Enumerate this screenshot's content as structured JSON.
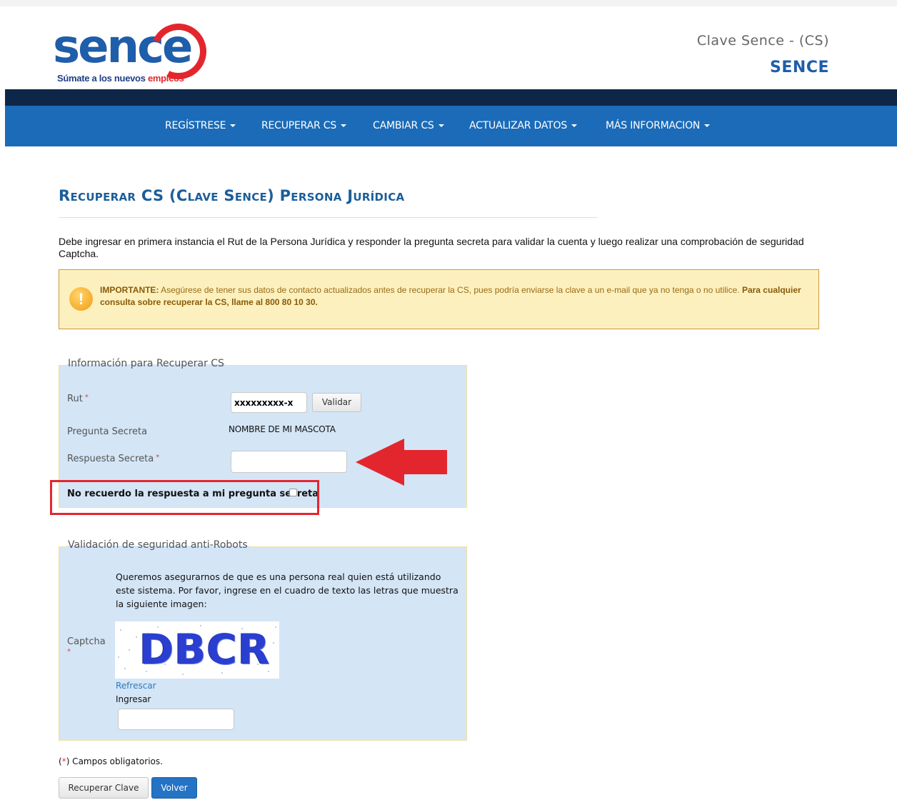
{
  "header": {
    "logo_word": "sence",
    "logo_tagline_prefix": "Súmate a los nuevos ",
    "logo_tagline_highlight": "empleos",
    "site_title": "Clave Sence - (CS)",
    "site_subtitle": "SENCE"
  },
  "nav": {
    "items": [
      {
        "label": "REGÍSTRESE"
      },
      {
        "label": "RECUPERAR CS"
      },
      {
        "label": "CAMBIAR CS"
      },
      {
        "label": "ACTUALIZAR DATOS"
      },
      {
        "label": "MÁS INFORMACION"
      }
    ]
  },
  "page": {
    "title": "Recuperar CS (Clave Sence) Persona Jurídica",
    "intro": "Debe ingresar en primera instancia el Rut de la Persona Jurídica y responder la pregunta secreta para validar la cuenta y luego realizar una comprobación de seguridad Captcha."
  },
  "alert": {
    "icon": "!",
    "strong_label": "IMPORTANTE:",
    "message": " Asegúrese de tener sus datos de contacto actualizados antes de recuperar la CS, pues podría enviarse la clave a un e-mail que ya no tenga o no utilice. ",
    "strong_contact": "Para cualquier consulta sobre recuperar la CS, llame al 800 80 10 30."
  },
  "recover_form": {
    "legend": "Información para Recuperar CS",
    "rut_label": "Rut",
    "rut_value": "xxxxxxxxx-x",
    "validate_button": "Validar",
    "question_label": "Pregunta Secreta",
    "question_value": "NOMBRE DE MI MASCOTA",
    "answer_label": "Respuesta Secreta",
    "answer_value": "",
    "forgot_label": "No recuerdo la respuesta a mi pregunta secreta",
    "required_mark": "*"
  },
  "captcha_form": {
    "legend": "Validación de seguridad anti-Robots",
    "description": "Queremos asegurarnos de que es una persona real quien está utilizando este sistema. Por favor, ingrese en el cuadro de texto las letras que muestra la siguiente imagen:",
    "captcha_label": "Captcha",
    "captcha_text": "DBCR",
    "refresh_link": "Refrescar",
    "enter_label": "Ingresar",
    "enter_value": ""
  },
  "footer": {
    "required_prefix": "(",
    "required_star": "*",
    "required_suffix": ") Campos obligatorios.",
    "recover_button": "Recuperar Clave",
    "back_button": "Volver"
  },
  "colors": {
    "brand_blue": "#1e5eaa",
    "nav_blue": "#1b6bb8",
    "nav_dark": "#0e2749",
    "brand_red": "#e3262e",
    "fieldset_bg": "#d4e5f6",
    "alert_bg": "#fcf1be"
  }
}
